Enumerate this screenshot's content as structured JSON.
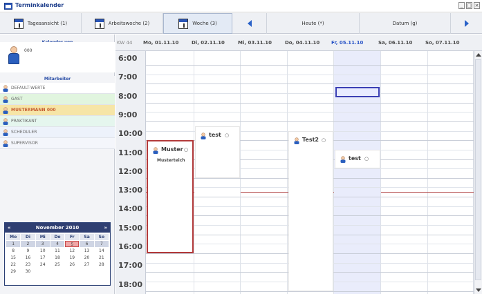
{
  "window": {
    "title": "Terminkalender",
    "controls": [
      "_",
      "□",
      "×"
    ]
  },
  "toolbar": {
    "day_view": "Tagesansicht (1)",
    "work_week_view": "Arbeitswoche (2)",
    "week_view": "Woche (3)",
    "today": "Heute (*)",
    "date": "Datum (g)"
  },
  "sidebar": {
    "calendar_of_label": "Kalender von",
    "calendar_user": "000",
    "staff_label": "Mitarbeiter",
    "staff": [
      {
        "name": "DEFAULT-WERTE",
        "bg": "#ffffff",
        "color": "#666666"
      },
      {
        "name": "GAST",
        "bg": "#e1f5df",
        "color": "#666666"
      },
      {
        "name": "MUSTERMANN 000",
        "bg": "#f6e5a7",
        "color": "#c45a2f"
      },
      {
        "name": "PRAKTIKANT",
        "bg": "#e5f6ee",
        "color": "#666666"
      },
      {
        "name": "SCHEDULER",
        "bg": "#edf2fb",
        "color": "#666666"
      },
      {
        "name": "SUPERVISOR",
        "bg": "#f4f6fb",
        "color": "#666666"
      }
    ]
  },
  "mini_calendar": {
    "month": "November 2010",
    "prev": "«",
    "next": "»",
    "weekdays": [
      "Mo",
      "Di",
      "Mi",
      "Do",
      "Fr",
      "Sa",
      "So"
    ],
    "weeks": [
      [
        "1",
        "2",
        "3",
        "4",
        "5",
        "6",
        "7"
      ],
      [
        "8",
        "9",
        "10",
        "11",
        "12",
        "13",
        "14"
      ],
      [
        "15",
        "16",
        "17",
        "18",
        "19",
        "20",
        "21"
      ],
      [
        "22",
        "23",
        "24",
        "25",
        "26",
        "27",
        "28"
      ],
      [
        "29",
        "30",
        "",
        "",
        "",
        "",
        ""
      ]
    ],
    "highlight_week": 0,
    "today": "5"
  },
  "calendar": {
    "week_label": "KW 44",
    "days": [
      "Mo, 01.11.10",
      "Di, 02.11.10",
      "Mi, 03.11.10",
      "Do, 04.11.10",
      "Fr, 05.11.10",
      "Sa, 06.11.10",
      "So, 07.11.10"
    ],
    "selected_day": 4,
    "hours": [
      "6:00",
      "7:00",
      "8:00",
      "9:00",
      "10:00",
      "11:00",
      "12:00",
      "13:00",
      "14:00",
      "15:00",
      "16:00",
      "17:00",
      "18:00"
    ]
  },
  "events": [
    {
      "title": "Muster",
      "location": "Musterteich",
      "day": "Mo, 01.11.10",
      "start": "10:00",
      "end": "16:00"
    },
    {
      "title": "test",
      "location": "",
      "day": "Di, 02.11.10",
      "start": "9:15",
      "end": "12:00"
    },
    {
      "title": "Test2",
      "location": "",
      "day": "Do, 04.11.10",
      "start": "9:30",
      "end": "18:00"
    },
    {
      "title": "test",
      "location": "",
      "day": "Fr, 05.11.10",
      "start": "10:30",
      "end": "11:30"
    }
  ]
}
